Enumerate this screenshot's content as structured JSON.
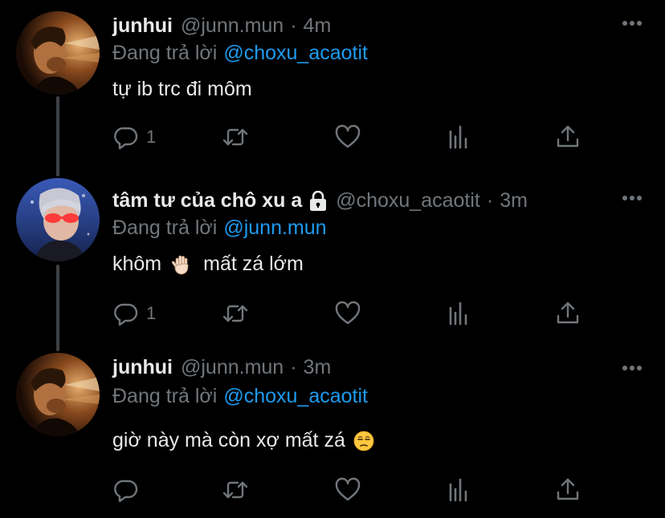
{
  "tweets": [
    {
      "name": "junhui",
      "handle": "@junn.mun",
      "time": "4m",
      "replying_prefix": "Đang trả lời",
      "replying_to": "@choxu_acaotit",
      "text": "tự ib trc đi môm",
      "reply_count": "1",
      "locked": false
    },
    {
      "name": "tâm tư của chô xu a",
      "handle": "@choxu_acaotit",
      "time": "3m",
      "replying_prefix": "Đang trả lời",
      "replying_to": "@junn.mun",
      "text_before_emoji": "khôm",
      "emoji": "raised-hand-emoji",
      "text_after_emoji": "mất zá lớm",
      "reply_count": "1",
      "locked": true
    },
    {
      "name": "junhui",
      "handle": "@junn.mun",
      "time": "3m",
      "replying_prefix": "Đang trả lời",
      "replying_to": "@choxu_acaotit",
      "text": "giờ này mà còn xợ mất zá",
      "emoji": "unamused-face-emoji",
      "reply_count": "",
      "locked": false
    }
  ],
  "separator": "·",
  "colors": {
    "background": "#000000",
    "primary_text": "#e7e9ea",
    "secondary_text": "#71767b",
    "mention": "#1d9bf0",
    "thread_line": "#3e4144"
  }
}
